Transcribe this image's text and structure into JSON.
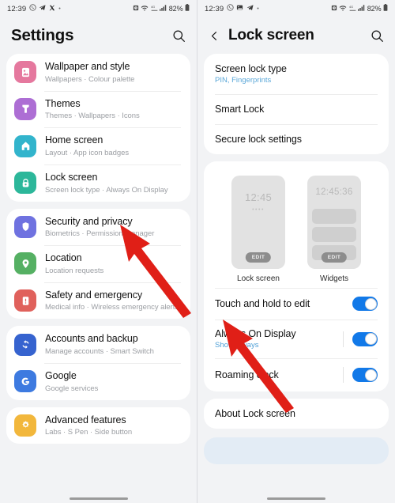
{
  "left_panel": {
    "statusbar": {
      "time": "12:39",
      "left_icons": [
        "whatsapp-icon",
        "telegram-icon",
        "x-icon",
        "dot-icon"
      ],
      "right_icons": [
        "alarm-icon",
        "wifi-calling-icon",
        "data-icon",
        "signal-icon"
      ],
      "battery": "82%"
    },
    "header": {
      "title": "Settings",
      "search_icon": "search-icon"
    },
    "groups": [
      {
        "items": [
          {
            "title": "Wallpaper and style",
            "subtitle": "Wallpapers  ·  Colour palette",
            "icon": "wallpaper-icon",
            "color": "#e5789e"
          },
          {
            "title": "Themes",
            "subtitle": "Themes  ·  Wallpapers  ·  Icons",
            "icon": "themes-icon",
            "color": "#ad6ed4"
          },
          {
            "title": "Home screen",
            "subtitle": "Layout  ·  App icon badges",
            "icon": "home-icon",
            "color": "#32b4cc"
          },
          {
            "title": "Lock screen",
            "subtitle": "Screen lock type  ·  Always On Display",
            "icon": "lock-icon",
            "color": "#2cb79a"
          }
        ]
      },
      {
        "items": [
          {
            "title": "Security and privacy",
            "subtitle": "Biometrics  ·  Permission manager",
            "icon": "shield-icon",
            "color": "#6f72e0"
          },
          {
            "title": "Location",
            "subtitle": "Location requests",
            "icon": "location-pin-icon",
            "color": "#55b063"
          },
          {
            "title": "Safety and emergency",
            "subtitle": "Medical info  ·  Wireless emergency alerts",
            "icon": "warning-icon",
            "color": "#e0615c"
          }
        ]
      },
      {
        "items": [
          {
            "title": "Accounts and backup",
            "subtitle": "Manage accounts  ·  Smart Switch",
            "icon": "sync-icon",
            "color": "#3663cf"
          },
          {
            "title": "Google",
            "subtitle": "Google services",
            "icon": "google-g-icon",
            "color": "#3d7ae0"
          }
        ]
      },
      {
        "items": [
          {
            "title": "Advanced features",
            "subtitle": "Labs  ·  S Pen  ·  Side button",
            "icon": "gear-star-icon",
            "color": "#f2b73c"
          }
        ]
      }
    ]
  },
  "right_panel": {
    "statusbar": {
      "time": "12:39",
      "left_icons": [
        "whatsapp-icon",
        "gallery-icon",
        "telegram-icon",
        "dot-icon"
      ],
      "right_icons": [
        "alarm-icon",
        "wifi-calling-icon",
        "data-icon",
        "signal-icon"
      ],
      "battery": "82%"
    },
    "header": {
      "back_icon": "back-chevron-icon",
      "title": "Lock screen",
      "search_icon": "search-icon"
    },
    "settings_group": [
      {
        "title": "Screen lock type",
        "subtitle": "PIN, Fingerprints"
      },
      {
        "title": "Smart Lock",
        "subtitle": ""
      },
      {
        "title": "Secure lock settings",
        "subtitle": ""
      }
    ],
    "previews": [
      {
        "label": "Lock screen",
        "clock": "12:45",
        "dots": "••••",
        "edit_label": "EDIT",
        "bars": 0
      },
      {
        "label": "Widgets",
        "clock": "12:45:36",
        "dots": "",
        "edit_label": "EDIT",
        "bars": 3
      }
    ],
    "toggles": [
      {
        "title": "Touch and hold to edit",
        "subtitle": "",
        "state": "on"
      },
      {
        "title": "Always On Display",
        "subtitle": "Show always",
        "state": "on"
      },
      {
        "title": "Roaming clock",
        "subtitle": "",
        "state": "on"
      }
    ],
    "about_row": {
      "title": "About Lock screen"
    },
    "tip_card": {
      "text": ""
    }
  },
  "annotations": {
    "arrow_left": "red-arrow-pointing-to-lock-screen",
    "arrow_right": "red-arrow-pointing-to-lock-screen-preview"
  }
}
